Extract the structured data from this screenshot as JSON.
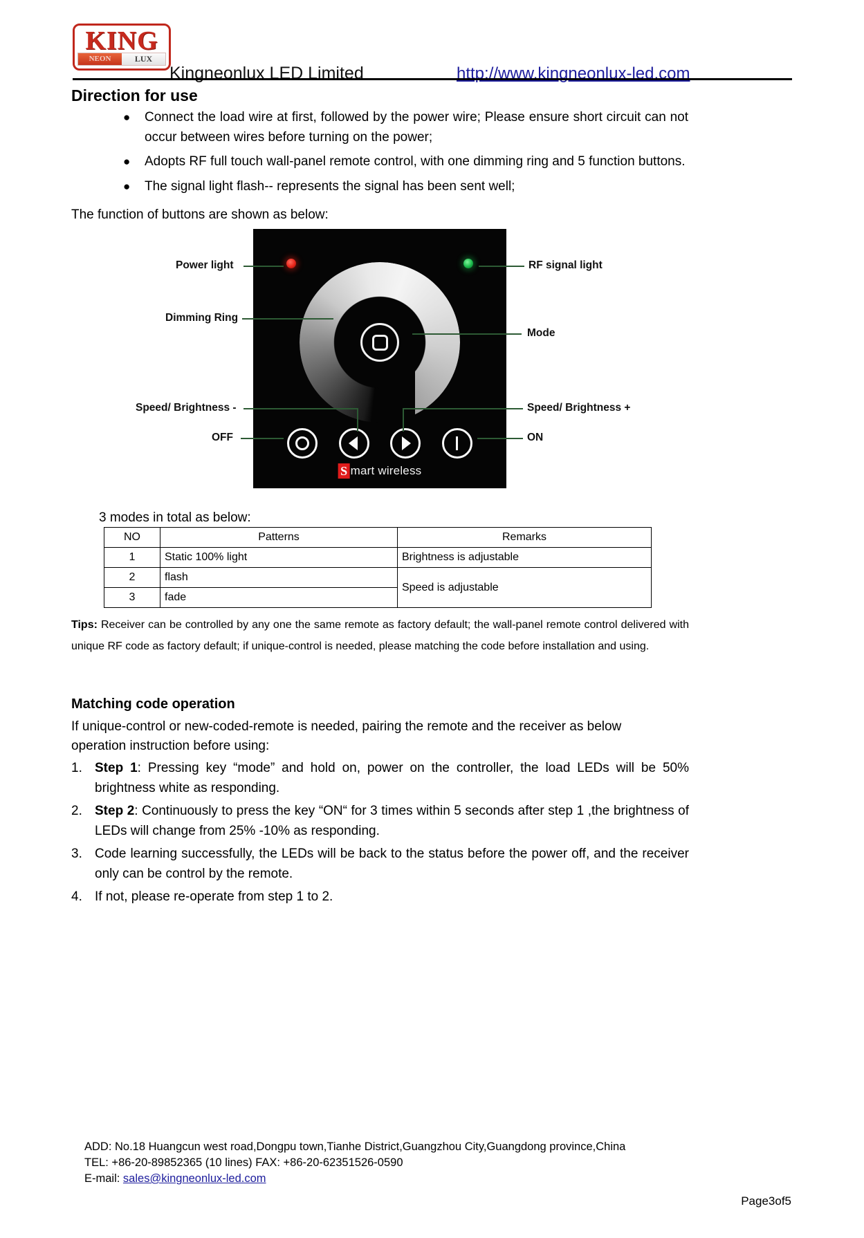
{
  "header": {
    "logo": {
      "main": "KING",
      "left_tag": "NEON",
      "right_tag": "LUX"
    },
    "company": "Kingneonlux LED Limited",
    "url": "http://www.kingneonlux-led.com"
  },
  "direction": {
    "title": "Direction for use",
    "bullets": [
      "Connect the load wire at first, followed by the power wire; Please ensure short circuit can not occur between wires before turning on the power;",
      "Adopts RF full touch wall-panel remote control, with one dimming ring and 5 function buttons.",
      "The signal light flash-- represents the signal has been sent well;"
    ],
    "bullet_glyph": "●",
    "function_line": "The function of buttons are shown as below:"
  },
  "device": {
    "brand_s": "S",
    "brand_text": "mart wireless",
    "callouts": {
      "power_light": "Power light",
      "rf_signal_light": "RF signal light",
      "dimming_ring": "Dimming Ring",
      "mode": "Mode",
      "speed_brightness_minus": "Speed/ Brightness -",
      "speed_brightness_plus": "Speed/ Brightness +",
      "off": "OFF",
      "on": "ON"
    },
    "colors": {
      "power_led": "#e8251a",
      "rf_led": "#19b94a",
      "leader_line": "#2d5a34",
      "panel_bg": "#050505"
    }
  },
  "modes": {
    "caption": "3 modes in total as below:",
    "columns": [
      "NO",
      "Patterns",
      "Remarks"
    ],
    "rows": [
      {
        "no": "1",
        "pattern": "Static 100% light",
        "remark": "Brightness is adjustable"
      },
      {
        "no": "2",
        "pattern": "flash",
        "remark": "Speed is adjustable"
      },
      {
        "no": "3",
        "pattern": "fade",
        "remark": ""
      }
    ]
  },
  "tips": {
    "label": "Tips:",
    "body": " Receiver can be controlled by any one the same remote as factory default; the wall-panel remote control delivered with unique RF code as factory default; if unique-control is needed, please matching the code before installation and using."
  },
  "matching": {
    "title": "Matching code operation",
    "intro_line1": "If unique-control or new-coded-remote is needed, pairing the remote and the receiver as below",
    "intro_line2": "operation instruction before using:",
    "steps": [
      {
        "num": "1.",
        "bold": "Step 1",
        "rest": ": Pressing key “mode” and hold on, power on the controller, the load LEDs will be 50% brightness white as responding."
      },
      {
        "num": "2.",
        "bold": "Step 2",
        "rest": ": Continuously to press the key “ON“ for 3 times within 5 seconds after step 1 ,the brightness of LEDs will change from 25% -10% as responding."
      },
      {
        "num": "3.",
        "bold": "",
        "rest": "Code learning successfully, the LEDs will be back to the status before the power off, and the receiver only can be control by the remote."
      },
      {
        "num": "4.",
        "bold": "",
        "rest": "If not, please re-operate from step 1 to 2."
      }
    ]
  },
  "footer": {
    "address": "ADD: No.18 Huangcun west road,Dongpu town,Tianhe District,Guangzhou City,Guangdong province,China",
    "phone": "TEL: +86-20-89852365 (10 lines) FAX: +86-20-62351526-0590",
    "email_label": "E-mail: ",
    "email": "sales@kingneonlux-led.com",
    "page": "Page3of5"
  }
}
